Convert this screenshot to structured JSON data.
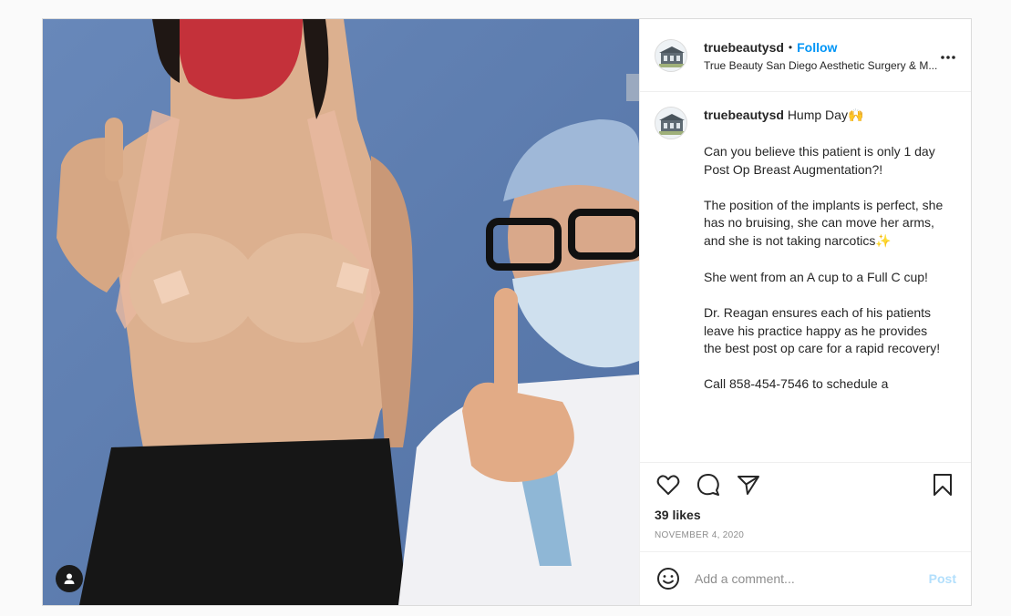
{
  "account": {
    "username": "truebeautysd",
    "follow_label": "Follow",
    "separator": "•",
    "subtitle": "True Beauty San Diego Aesthetic Surgery & M...",
    "more_label": "•••"
  },
  "caption": {
    "username": "truebeautysd",
    "first_line": "Hump Day",
    "first_emoji": "🙌",
    "paragraphs": [
      "Can you believe this patient is only 1 day Post Op Breast Augmentation?!",
      "The position of the implants is perfect, she has no bruising, she can move her arms, and she is not taking narcotics",
      "She went from an A cup to a Full C cup!",
      "Dr. Reagan ensures each of his patients leave his practice happy as he provides the best post op care for a rapid recovery!",
      "Call 858-454-7546 to schedule a"
    ],
    "narcotics_emoji": "✨"
  },
  "stats": {
    "likes": "39 likes",
    "date": "NOVEMBER 4, 2020"
  },
  "comment_box": {
    "placeholder": "Add a comment...",
    "post_label": "Post"
  },
  "icons": {
    "like": "heart-icon",
    "comment": "comment-bubble-icon",
    "share": "paper-plane-icon",
    "save": "bookmark-icon",
    "emoji": "smiley-icon",
    "tagged": "user-tag-icon"
  },
  "colors": {
    "accent": "#0095f6",
    "post_disabled": "#b2dffc",
    "muted": "#8e8e8e",
    "border": "#dbdbdb"
  }
}
